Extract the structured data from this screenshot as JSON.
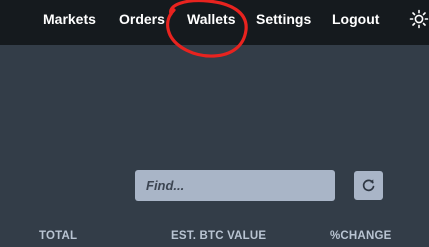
{
  "nav": {
    "items": [
      {
        "label": "Markets"
      },
      {
        "label": "Orders"
      },
      {
        "label": "Wallets"
      },
      {
        "label": "Settings"
      },
      {
        "label": "Logout"
      }
    ],
    "theme_icon": "sun-icon",
    "annotation_color": "#e8231f"
  },
  "search": {
    "placeholder": "Find..."
  },
  "refresh": {
    "icon": "refresh-icon"
  },
  "table": {
    "columns": [
      "TOTAL",
      "EST. BTC VALUE",
      "%CHANGE"
    ]
  },
  "colors": {
    "nav_background": "#151a1e",
    "page_background": "#333d48",
    "input_background": "#a9b5c7",
    "header_text": "#b9c4d2"
  }
}
